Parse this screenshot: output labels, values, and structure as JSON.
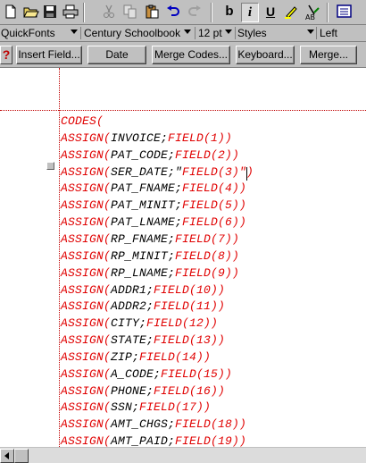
{
  "toolbar": {
    "buttons": [
      {
        "name": "new-document-icon"
      },
      {
        "name": "open-folder-icon"
      },
      {
        "name": "save-disk-icon"
      },
      {
        "name": "print-icon"
      },
      {
        "name": "cut-icon"
      },
      {
        "name": "copy-icon"
      },
      {
        "name": "paste-icon"
      },
      {
        "name": "undo-icon"
      },
      {
        "name": "redo-icon"
      },
      {
        "name": "bold-icon",
        "label": "b"
      },
      {
        "name": "italic-icon",
        "label": "i"
      },
      {
        "name": "underline-icon",
        "label": "U"
      },
      {
        "name": "highlight-icon"
      },
      {
        "name": "font-color-icon"
      },
      {
        "name": "view-icon"
      }
    ]
  },
  "fontbar": {
    "quickfonts": "QuickFonts",
    "font_name": "Century Schoolbook",
    "font_size": "12 pt",
    "styles": "Styles",
    "justification": "Left"
  },
  "merge_bar": {
    "help_icon": "?",
    "insert_field": "Insert Field...",
    "date": "Date",
    "merge_codes": "Merge Codes...",
    "keyboard": "Keyboard...",
    "merge": "Merge..."
  },
  "document": {
    "lines": [
      {
        "kw": "CODES(",
        "arg": "",
        "fn": "",
        "close": ""
      },
      {
        "kw": "ASSIGN(",
        "arg": "INVOICE;",
        "fn": "FIELD(1)",
        "close": ")"
      },
      {
        "kw": "ASSIGN(",
        "arg": "PAT_CODE;",
        "fn": "FIELD(2)",
        "close": ")"
      },
      {
        "kw": "ASSIGN(",
        "arg": "SER_DATE;\"",
        "fn": "FIELD(3)",
        "close": "\")"
      },
      {
        "kw": "ASSIGN(",
        "arg": "PAT_FNAME;",
        "fn": "FIELD(4)",
        "close": ")"
      },
      {
        "kw": "ASSIGN(",
        "arg": "PAT_MINIT;",
        "fn": "FIELD(5)",
        "close": ")"
      },
      {
        "kw": "ASSIGN(",
        "arg": "PAT_LNAME;",
        "fn": "FIELD(6)",
        "close": ")"
      },
      {
        "kw": "ASSIGN(",
        "arg": "RP_FNAME;",
        "fn": "FIELD(7)",
        "close": ")"
      },
      {
        "kw": "ASSIGN(",
        "arg": "RP_MINIT;",
        "fn": "FIELD(8)",
        "close": ")"
      },
      {
        "kw": "ASSIGN(",
        "arg": "RP_LNAME;",
        "fn": "FIELD(9)",
        "close": ")"
      },
      {
        "kw": "ASSIGN(",
        "arg": "ADDR1;",
        "fn": "FIELD(10)",
        "close": ")"
      },
      {
        "kw": "ASSIGN(",
        "arg": "ADDR2;",
        "fn": "FIELD(11)",
        "close": ")"
      },
      {
        "kw": "ASSIGN(",
        "arg": "CITY;",
        "fn": "FIELD(12)",
        "close": ")"
      },
      {
        "kw": "ASSIGN(",
        "arg": "STATE;",
        "fn": "FIELD(13)",
        "close": ")"
      },
      {
        "kw": "ASSIGN(",
        "arg": "ZIP;",
        "fn": "FIELD(14)",
        "close": ")"
      },
      {
        "kw": "ASSIGN(",
        "arg": "A_CODE;",
        "fn": "FIELD(15)",
        "close": ")"
      },
      {
        "kw": "ASSIGN(",
        "arg": "PHONE;",
        "fn": "FIELD(16)",
        "close": ")"
      },
      {
        "kw": "ASSIGN(",
        "arg": "SSN;",
        "fn": "FIELD(17)",
        "close": ")"
      },
      {
        "kw": "ASSIGN(",
        "arg": "AMT_CHGS;",
        "fn": "FIELD(18)",
        "close": ")"
      },
      {
        "kw": "ASSIGN(",
        "arg": "AMT_PAID;",
        "fn": "FIELD(19)",
        "close": ")"
      }
    ]
  },
  "colors": {
    "code_keyword": "#e00000",
    "code_argument": "#000000",
    "guide_line": "#c00000",
    "chrome": "#c0c0c0"
  }
}
